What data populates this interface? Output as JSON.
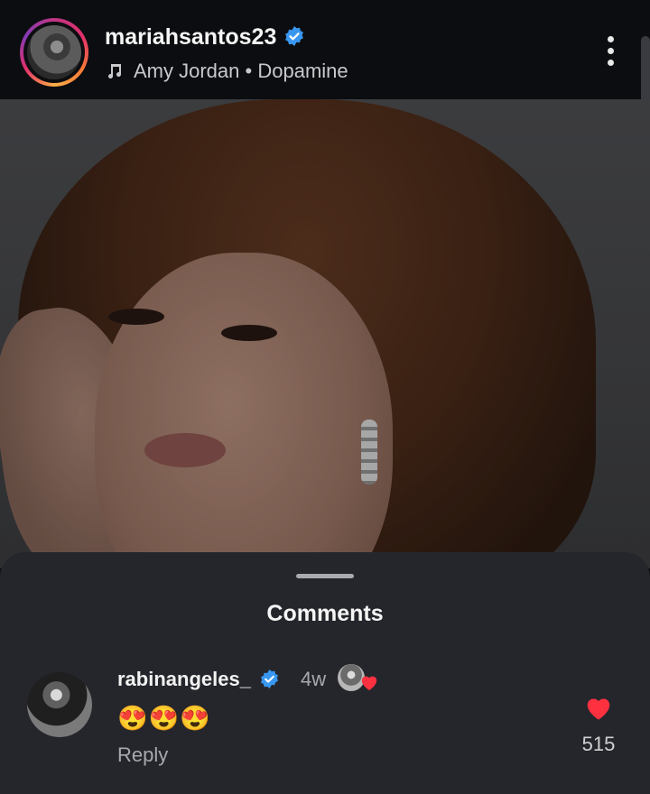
{
  "header": {
    "username": "mariahsantos23",
    "music_artist": "Amy Jordan",
    "music_separator": "•",
    "music_track": "Dopamine"
  },
  "comments_sheet": {
    "title": "Comments",
    "comments": [
      {
        "username": "rabinangeles_",
        "time": "4w",
        "text": "😍😍😍",
        "reply_label": "Reply",
        "like_count": "515"
      }
    ]
  },
  "colors": {
    "background": "#0c0d10",
    "sheet": "#25262b",
    "verified_blue": "#3897f0",
    "like_red": "#ff3040"
  },
  "icons": [
    "verified-badge-icon",
    "music-note-icon",
    "more-options-icon",
    "heart-icon"
  ]
}
